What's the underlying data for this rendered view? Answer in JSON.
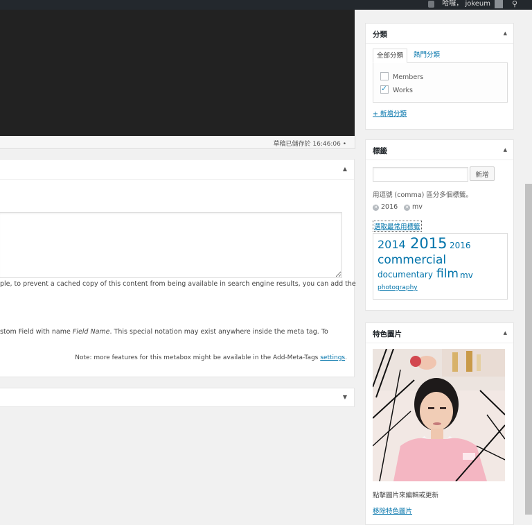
{
  "admin_bar": {
    "greeting": "哈囉，",
    "username": "jokeum",
    "icons": [
      "notification-icon",
      "avatar",
      "search-icon"
    ]
  },
  "editor": {
    "autosave_text": "草稿已儲存於 16:46:06 •"
  },
  "meta_box": {
    "textarea_value": "",
    "description_1": "ple, to prevent a cached copy of this content from being available in search engine results, you can add the",
    "description_2_prefix": "stom Field with name ",
    "description_2_em": "Field Name",
    "description_2_suffix": ". This special notation may exist anywhere inside the meta tag. To",
    "note_prefix": "Note: more features for this metabox might be available in the Add-Meta-Tags ",
    "note_link": "settings",
    "note_suffix": "."
  },
  "categories": {
    "title": "分類",
    "tabs": [
      "全部分類",
      "熱門分類"
    ],
    "items": [
      {
        "label": "Members",
        "checked": false
      },
      {
        "label": "Works",
        "checked": true
      }
    ],
    "add_link": "+ 新增分類"
  },
  "tags": {
    "title": "標籤",
    "input_value": "",
    "add_button": "新增",
    "hint": "用逗號 (comma) 區分多個標籤。",
    "assigned": [
      "2016",
      "mv"
    ],
    "choose_link": "選取最常用標籤",
    "cloud": [
      "2014",
      "2015",
      "2016",
      "commercial",
      "documentary",
      "film",
      "mv",
      "photography"
    ]
  },
  "featured_image": {
    "title": "特色圖片",
    "caption": "點擊圖片來編輯或更新",
    "remove_link": "移除特色圖片"
  },
  "colors": {
    "link": "#0073aa",
    "admin_bar": "#23282d",
    "editor_dark": "#222222"
  }
}
